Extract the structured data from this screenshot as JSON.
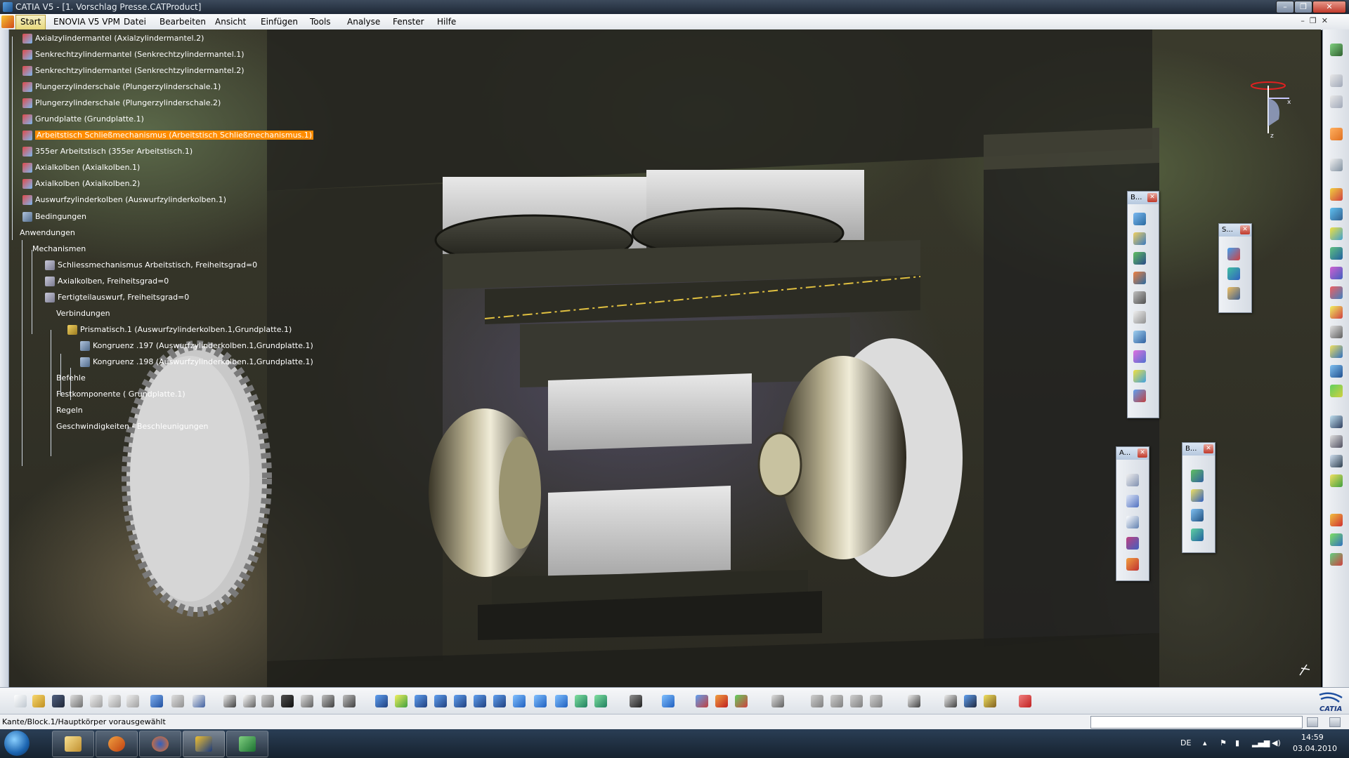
{
  "window": {
    "title": "CATIA V5 - [1. Vorschlag Presse.CATProduct]"
  },
  "menu": {
    "start": "Start",
    "items": [
      "ENOVIA V5 VPM",
      "Datei",
      "Bearbeiten",
      "Ansicht",
      "Einfügen",
      "Tools",
      "Analyse",
      "Fenster",
      "Hilfe"
    ]
  },
  "tree": {
    "items": [
      {
        "label": "Axialzylindermantel (Axialzylindermantel.2)",
        "icon": "part"
      },
      {
        "label": "Senkrechtzylindermantel (Senkrechtzylindermantel.1)",
        "icon": "part"
      },
      {
        "label": "Senkrechtzylindermantel (Senkrechtzylindermantel.2)",
        "icon": "part"
      },
      {
        "label": "Plungerzylinderschale (Plungerzylinderschale.1)",
        "icon": "part"
      },
      {
        "label": "Plungerzylinderschale (Plungerzylinderschale.2)",
        "icon": "part"
      },
      {
        "label": "Grundplatte (Grundplatte.1)",
        "icon": "part"
      },
      {
        "label": "Arbeitstisch Schließmechanismus (Arbeitstisch Schließmechanismus.1)",
        "icon": "part"
      },
      {
        "label": "355er Arbeitstisch (355er Arbeitstisch.1)",
        "icon": "part"
      },
      {
        "label": "Axialkolben (Axialkolben.1)",
        "icon": "part"
      },
      {
        "label": "Axialkolben (Axialkolben.2)",
        "icon": "part"
      },
      {
        "label": "Auswurfzylinderkolben (Auswurfzylinderkolben.1)",
        "icon": "part"
      },
      {
        "label": "Bedingungen",
        "icon": "cons"
      },
      {
        "label": "Anwendungen",
        "icon": "none"
      },
      {
        "label": "Mechanismen",
        "icon": "none"
      },
      {
        "label": "Schliessmechanismus Arbeitstisch, Freiheitsgrad=0",
        "icon": "mech"
      },
      {
        "label": "Axialkolben, Freiheitsgrad=0",
        "icon": "mech"
      },
      {
        "label": "Fertigteilauswurf, Freiheitsgrad=0",
        "icon": "mech"
      },
      {
        "label": "Verbindungen",
        "icon": "none"
      },
      {
        "label": "Prismatisch.1 (Auswurfzylinderkolben.1,Grundplatte.1)",
        "icon": "join"
      },
      {
        "label": "Kongruenz .197 (Auswurfzylinderkolben.1,Grundplatte.1)",
        "icon": "cons"
      },
      {
        "label": "Kongruenz .198 (Auswurfzylinderkolben.1,Grundplatte.1)",
        "icon": "cons"
      },
      {
        "label": "Befehle",
        "icon": "none"
      },
      {
        "label": "Festkomponente ( Grundplatte.1)",
        "icon": "none"
      },
      {
        "label": "Regeln",
        "icon": "none"
      },
      {
        "label": "Geschwindigkeiten - Beschleunigungen",
        "icon": "none"
      }
    ],
    "selected_index": 6
  },
  "floating_toolbars": [
    {
      "title": "B...",
      "icons": [
        "assembly-constraint-icon",
        "part-icon",
        "sub-assembly-icon",
        "move-icon",
        "snap-icon",
        "clash-icon",
        "section-icon",
        "spec-icon",
        "swap-icon",
        "explode-icon"
      ]
    },
    {
      "title": "S...",
      "icons": [
        "simulation-icon",
        "compile-icon",
        "replay-icon"
      ]
    },
    {
      "title": "A...",
      "icons": [
        "annotation-icon",
        "text-icon",
        "flag-icon",
        "weld-icon",
        "stamp-icon"
      ]
    },
    {
      "title": "B...",
      "icons": [
        "bom-icon",
        "catalog-icon",
        "scene-icon",
        "filter-icon"
      ]
    }
  ],
  "compass": {
    "x_label": "x",
    "z_label": "z"
  },
  "status": {
    "message": "Kante/Block.1/Hauptkörper vorausgewählt"
  },
  "taskbar": {
    "lang": "DE",
    "time": "14:59",
    "date": "03.04.2010"
  },
  "brand": {
    "logo_text": "CATIA"
  },
  "colors": {
    "selection": "#ff8c00",
    "viewport_bg": "#3a3a2c"
  }
}
